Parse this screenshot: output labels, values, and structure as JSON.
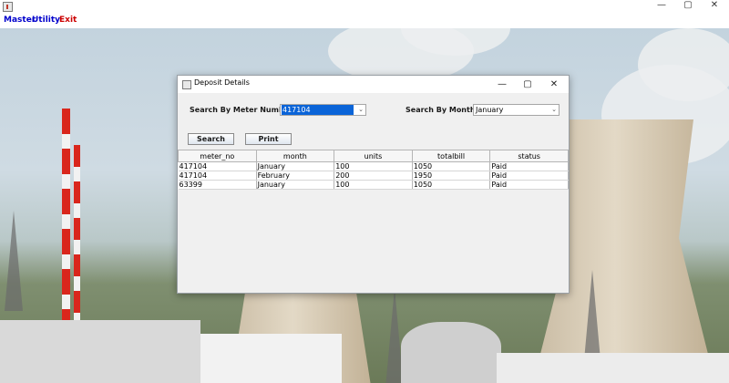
{
  "window": {
    "controls": {
      "minimize": "—",
      "maximize": "▢",
      "close": "✕"
    }
  },
  "menu": [
    {
      "label": "Master",
      "color": "#0000cc"
    },
    {
      "label": "Utility",
      "color": "#0000cc"
    },
    {
      "label": "Exit",
      "color": "#cc0000"
    }
  ],
  "dialog": {
    "title": "Deposit Details",
    "controls": {
      "minimize": "—",
      "maximize": "▢",
      "close": "✕"
    },
    "meter_label": "Search By Meter Number",
    "meter_value": "417104",
    "month_label": "Search By Month",
    "month_value": "January",
    "search_button": "Search",
    "print_button": "Print",
    "table": {
      "columns": [
        "meter_no",
        "month",
        "units",
        "totalbill",
        "status"
      ],
      "rows": [
        [
          "417104",
          "January",
          "100",
          "1050",
          "Paid"
        ],
        [
          "417104",
          "February",
          "200",
          "1950",
          "Paid"
        ],
        [
          "63399",
          "January",
          "100",
          "1050",
          "Paid"
        ]
      ]
    }
  },
  "colors": {
    "selection": "#0a64d8",
    "dialog_bg": "#f0f0f0"
  }
}
